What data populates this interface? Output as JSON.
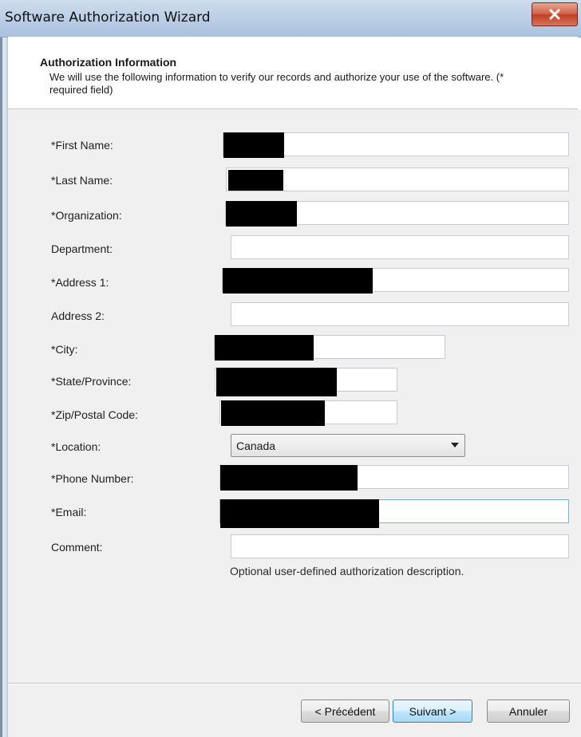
{
  "window": {
    "title": "Software Authorization Wizard"
  },
  "header": {
    "title": "Authorization Information",
    "description": "We will use the following information to verify our records and authorize your use of the software. (* required field)"
  },
  "form": {
    "fields": [
      {
        "label": "*First Name:",
        "value": ""
      },
      {
        "label": "*Last Name:",
        "value": ""
      },
      {
        "label": "*Organization:",
        "value": ""
      },
      {
        "label": "Department:",
        "value": ""
      },
      {
        "label": "*Address 1:",
        "value": ""
      },
      {
        "label": "Address 2:",
        "value": ""
      },
      {
        "label": "*City:",
        "value": ""
      },
      {
        "label": "*State/Province:",
        "value": ""
      },
      {
        "label": "*Zip/Postal Code:",
        "value": ""
      },
      {
        "label": "*Location:",
        "value": "Canada"
      },
      {
        "label": "*Phone Number:",
        "value": ""
      },
      {
        "label": "*Email:",
        "value": ""
      },
      {
        "label": "Comment:",
        "value": ""
      }
    ],
    "comment_help": "Optional user-defined authorization description."
  },
  "buttons": {
    "back": "< Précédent",
    "next": "Suivant >",
    "cancel": "Annuler"
  },
  "icons": {
    "close": "close-icon",
    "dropdown": "chevron-down-icon"
  }
}
